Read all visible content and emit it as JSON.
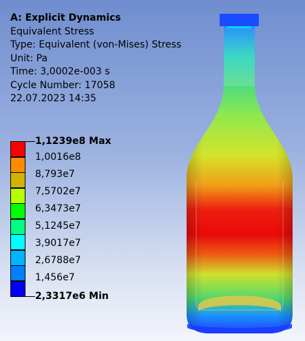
{
  "header": {
    "title": "A: Explicit Dynamics",
    "result": "Equivalent Stress",
    "type": "Type: Equivalent (von-Mises) Stress",
    "unit": "Unit: Pa",
    "time": "Time: 3,0002e-003 s",
    "cycle": "Cycle Number: 17058",
    "date": "22.07.2023 14:35"
  },
  "legend": {
    "max_label": "1,1239e8 Max",
    "min_label": "2,3317e6 Min",
    "values": [
      "1,0016e8",
      "8,793e7",
      "7,5702e7",
      "6,3473e7",
      "5,1245e7",
      "3,9017e7",
      "2,6788e7",
      "1,456e7"
    ],
    "colors": [
      "#ff0000",
      "#ff8c00",
      "#d2b400",
      "#b4ff00",
      "#00ff00",
      "#00ff80",
      "#00ffff",
      "#00b4ff",
      "#0080ff",
      "#0000ff"
    ]
  },
  "model": {
    "icon": "stressed-bottle-geometry"
  }
}
